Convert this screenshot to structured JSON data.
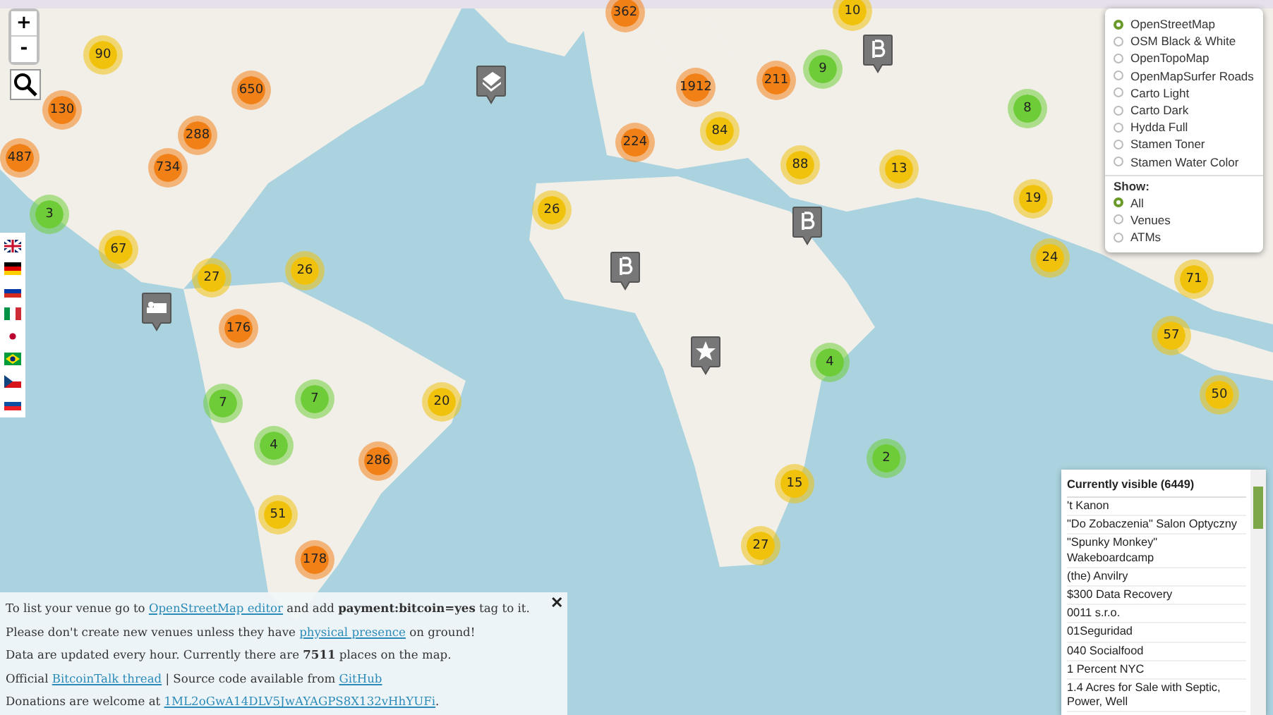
{
  "zoom_controls": {
    "zoom_in": "+",
    "zoom_out": "-"
  },
  "clusters": [
    {
      "count": "362",
      "color": "#f18017"
    },
    {
      "count": "10",
      "color": "#f0c20c"
    },
    {
      "count": "90",
      "color": "#f0c20c"
    },
    {
      "count": "650",
      "color": "#f18017"
    },
    {
      "count": "1912",
      "color": "#f18017"
    },
    {
      "count": "211",
      "color": "#f18017"
    },
    {
      "count": "9",
      "color": "#6ecc39"
    },
    {
      "count": "130",
      "color": "#f18017"
    },
    {
      "count": "288",
      "color": "#f18017"
    },
    {
      "count": "8",
      "color": "#6ecc39"
    },
    {
      "count": "487",
      "color": "#f18017"
    },
    {
      "count": "734",
      "color": "#f18017"
    },
    {
      "count": "224",
      "color": "#f18017"
    },
    {
      "count": "84",
      "color": "#f0c20c"
    },
    {
      "count": "88",
      "color": "#f0c20c"
    },
    {
      "count": "13",
      "color": "#f0c20c"
    },
    {
      "count": "19",
      "color": "#f0c20c"
    },
    {
      "count": "3",
      "color": "#6ecc39"
    },
    {
      "count": "26",
      "color": "#f0c20c"
    },
    {
      "count": "67",
      "color": "#f0c20c"
    },
    {
      "count": "27",
      "color": "#f0c20c"
    },
    {
      "count": "26",
      "color": "#f0c20c"
    },
    {
      "count": "24",
      "color": "#f0c20c"
    },
    {
      "count": "71",
      "color": "#f0c20c"
    },
    {
      "count": "176",
      "color": "#f18017"
    },
    {
      "count": "57",
      "color": "#f0c20c"
    },
    {
      "count": "7",
      "color": "#6ecc39"
    },
    {
      "count": "7",
      "color": "#6ecc39"
    },
    {
      "count": "20",
      "color": "#f0c20c"
    },
    {
      "count": "4",
      "color": "#6ecc39"
    },
    {
      "count": "50",
      "color": "#f0c20c"
    },
    {
      "count": "4",
      "color": "#6ecc39"
    },
    {
      "count": "286",
      "color": "#f18017"
    },
    {
      "count": "2",
      "color": "#6ecc39"
    },
    {
      "count": "15",
      "color": "#f0c20c"
    },
    {
      "count": "51",
      "color": "#f0c20c"
    },
    {
      "count": "178",
      "color": "#f18017"
    },
    {
      "count": "27",
      "color": "#f0c20c"
    }
  ],
  "layers": {
    "base_layers": [
      {
        "label": "OpenStreetMap",
        "selected": true
      },
      {
        "label": "OSM Black & White",
        "selected": false
      },
      {
        "label": "OpenTopoMap",
        "selected": false
      },
      {
        "label": "OpenMapSurfer Roads",
        "selected": false
      },
      {
        "label": "Carto Light",
        "selected": false
      },
      {
        "label": "Carto Dark",
        "selected": false
      },
      {
        "label": "Hydda Full",
        "selected": false
      },
      {
        "label": "Stamen Toner",
        "selected": false
      },
      {
        "label": "Stamen Water Color",
        "selected": false
      }
    ],
    "show_title": "Show:",
    "show_options": [
      {
        "label": "All",
        "selected": true
      },
      {
        "label": "Venues",
        "selected": false
      },
      {
        "label": "ATMs",
        "selected": false
      }
    ]
  },
  "info_panel": {
    "close": "✕",
    "lines": [
      [
        {
          "kind": "text",
          "text": "To list your venue go to "
        },
        {
          "kind": "link",
          "text": "OpenStreetMap editor"
        },
        {
          "kind": "text",
          "text": " and add **payment:bitcoin=yes** tag to it."
        }
      ],
      [
        {
          "kind": "text",
          "text": "Please don't create new venues unless they have "
        },
        {
          "kind": "link",
          "text": "physical presence"
        },
        {
          "kind": "text",
          "text": " on ground!"
        }
      ],
      [
        {
          "kind": "text",
          "text": "Data are updated every hour. Currently there are **7511** places on the map."
        }
      ],
      [
        {
          "kind": "text",
          "text": "Official "
        },
        {
          "kind": "link",
          "text": "BitcoinTalk thread"
        },
        {
          "kind": "text",
          "text": " | Source code available from "
        },
        {
          "kind": "link",
          "text": "GitHub"
        }
      ],
      [
        {
          "kind": "text",
          "text": "Donations are welcome at "
        },
        {
          "kind": "link",
          "text": "1ML2oGwA14DLV5JwAYAGPS8X132vHhYUFi"
        },
        {
          "kind": "text",
          "text": "."
        }
      ]
    ]
  },
  "visible_list": {
    "title": "Currently visible (6449)",
    "items": [
      "'t Kanon",
      "\"Do Zobaczenia\" Salon Optyczny",
      "\"Spunky Monkey\" Wakeboardcamp",
      "(the) Anvilry",
      "$300 Data Recovery",
      "0011 s.r.o.",
      "01Seguridad",
      "040 Socialfood",
      "1 Percent NYC",
      "1.4 Acres for Sale with Septic, Power, Well"
    ]
  }
}
